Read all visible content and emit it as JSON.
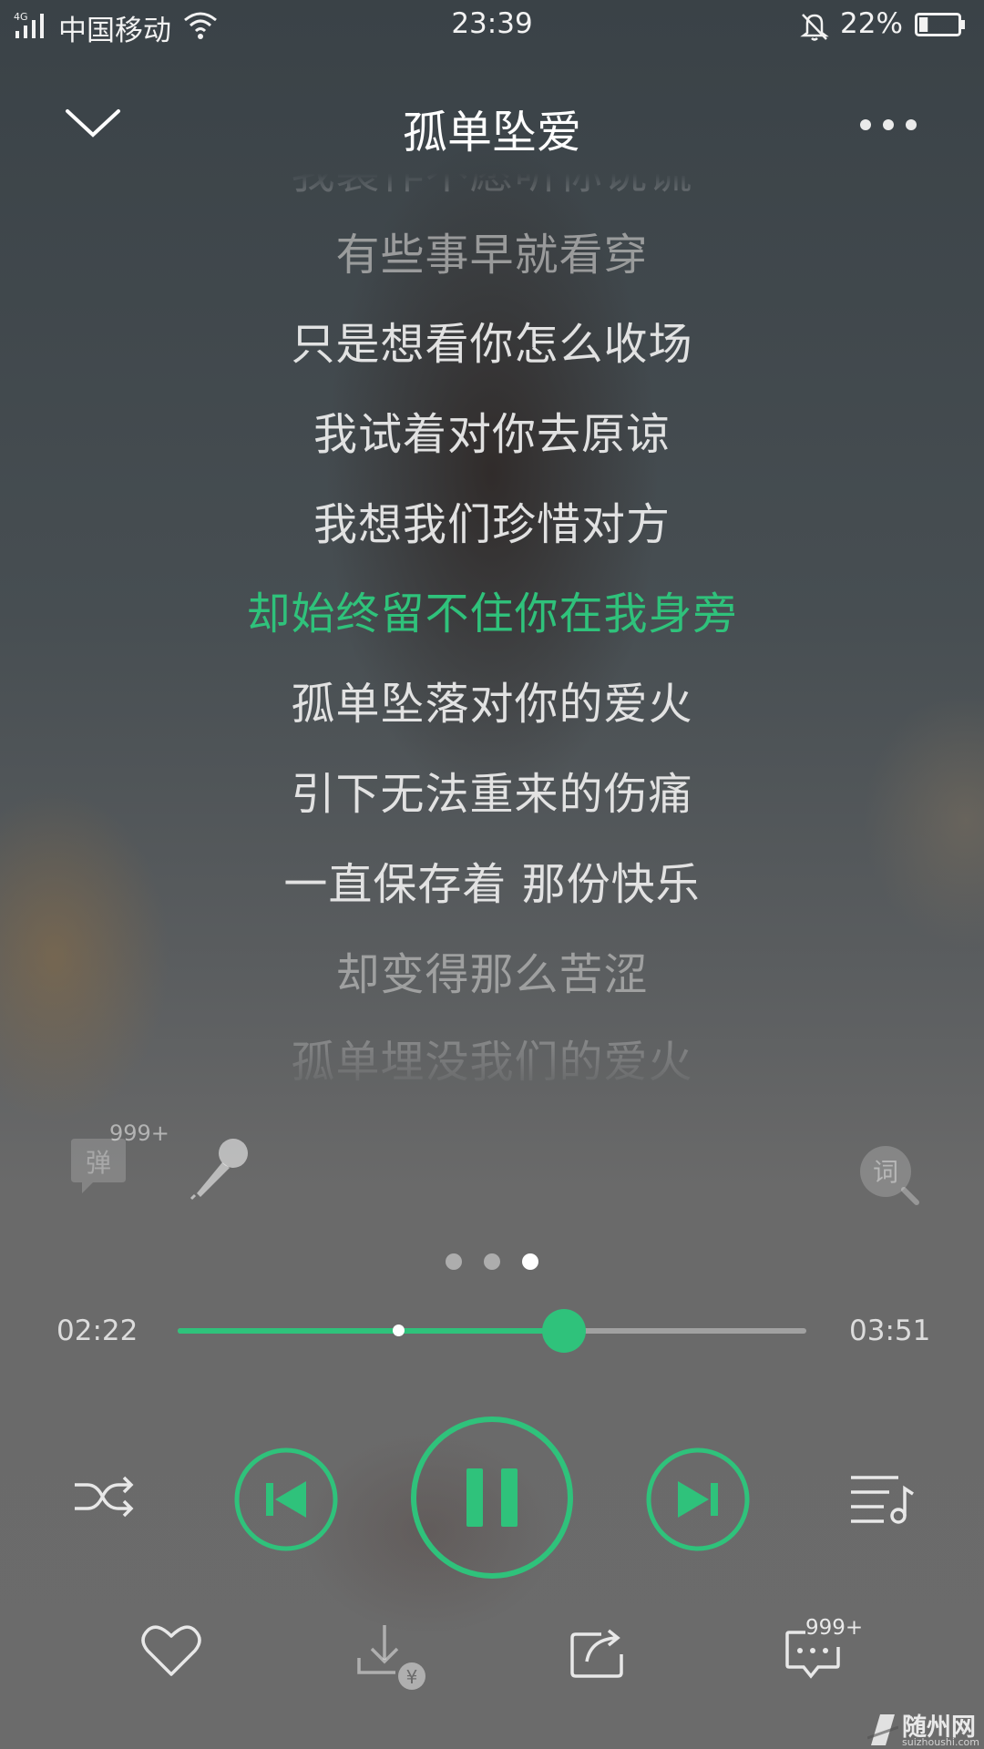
{
  "status_bar": {
    "network": "4G",
    "carrier": "中国移动",
    "time": "23:39",
    "battery": "22%",
    "battery_level": 0.22
  },
  "header": {
    "title": "孤单坠爱"
  },
  "lyrics": {
    "lines": [
      "我装作不愿听你说谎",
      "有些事早就看穿",
      "只是想看你怎么收场",
      "我试着对你去原谅",
      "我想我们珍惜对方",
      "却始终留不住你在我身旁",
      "孤单坠落对你的爱火",
      "引下无法重来的伤痛",
      "一直保存着 那份快乐",
      "却变得那么苦涩",
      "孤单埋没我们的爱火"
    ],
    "current_index": 5
  },
  "tools": {
    "danmu_label": "弹",
    "danmu_count": "999+",
    "lyric_search_label": "词"
  },
  "pager": {
    "count": 3,
    "active": 2
  },
  "progress": {
    "current": "02:22",
    "duration": "03:51",
    "played_fraction": 0.615,
    "buffered_fraction": 0.35
  },
  "actions": {
    "comment_count": "999+",
    "download_badge": "¥"
  },
  "watermark": {
    "name": "随州网",
    "domain": "suizhoushi.com"
  },
  "colors": {
    "accent": "#2fc27b"
  }
}
